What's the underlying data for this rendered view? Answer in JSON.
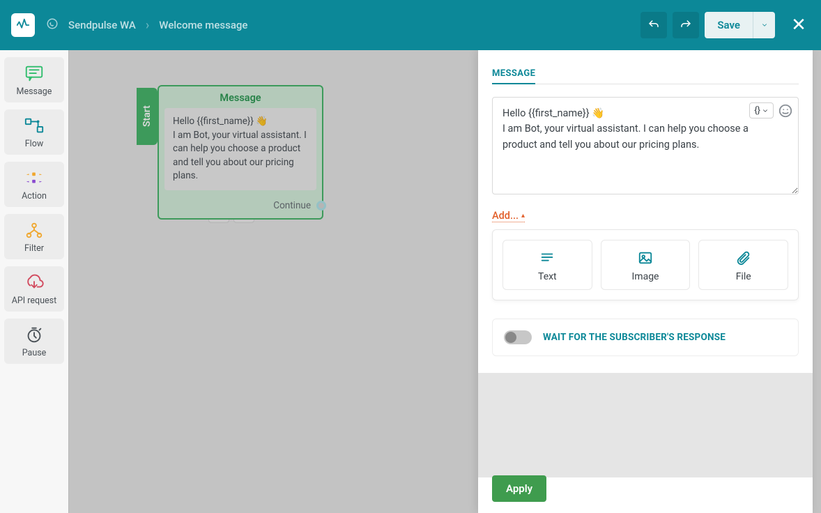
{
  "header": {
    "bot_name": "Sendpulse WA",
    "flow_name": "Welcome message",
    "save_label": "Save"
  },
  "toolbox": {
    "message": "Message",
    "flow": "Flow",
    "action": "Action",
    "filter": "Filter",
    "api": "API request",
    "pause": "Pause"
  },
  "canvas": {
    "start_label": "Start",
    "node_title": "Message",
    "node_body": "Hello {{first_name}} 👋\nI am Bot, your virtual assistant. I can help you choose a product and tell you about our pricing plans.",
    "continue_label": "Continue"
  },
  "panel": {
    "tab_label": "MESSAGE",
    "message_text": "Hello {{first_name}} 👋\nI am Bot, your virtual assistant. I can help you choose a product and tell you about our pricing plans.",
    "variable_pill": "{}",
    "add_label": "Add...",
    "opt_text": "Text",
    "opt_image": "Image",
    "opt_file": "File",
    "wait_label": "WAIT FOR THE SUBSCRIBER'S RESPONSE",
    "apply_label": "Apply"
  }
}
